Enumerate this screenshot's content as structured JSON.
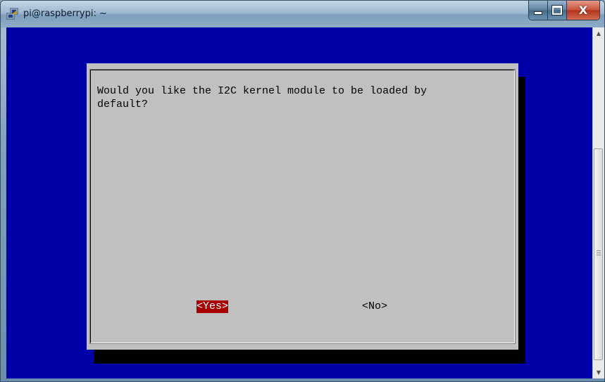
{
  "window": {
    "title": "pi@raspberrypi: ~",
    "app_icon": "putty-icon",
    "controls": {
      "minimize_icon": "minimize-icon",
      "maximize_icon": "maximize-icon",
      "close_icon": "close-icon",
      "close_glyph": "X"
    }
  },
  "terminal": {
    "background_color": "#0000a8",
    "dialog": {
      "message": "Would you like the I2C kernel module to be loaded by\ndefault?",
      "buttons": {
        "yes": "<Yes>",
        "no": "<No>"
      },
      "selected_button": "yes",
      "selected_color": "#a80000"
    }
  },
  "scrollbar": {
    "up_glyph": "▲",
    "down_glyph": "▼"
  }
}
